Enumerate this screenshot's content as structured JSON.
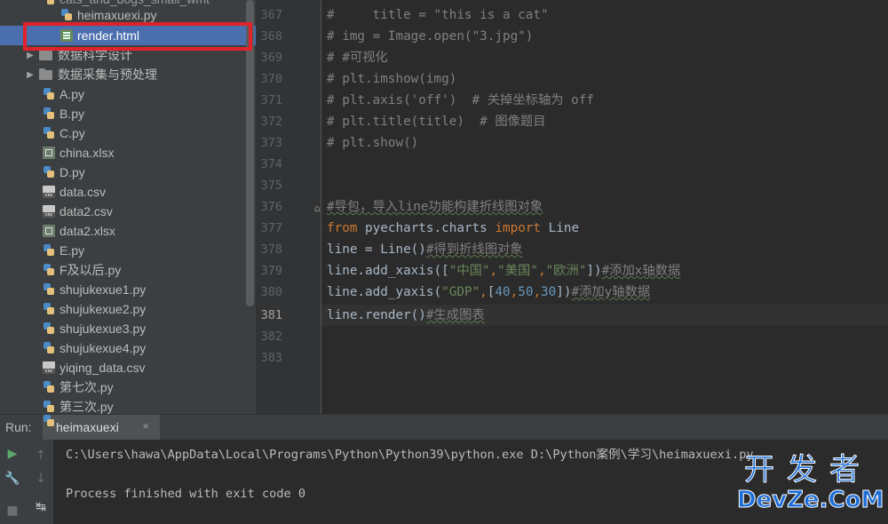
{
  "project_tree": {
    "items": [
      {
        "label": "cats_and_dogs_small_wmt",
        "type": "py",
        "indent": 2
      },
      {
        "label": "heimaxuexi.py",
        "type": "py",
        "indent": 2
      },
      {
        "label": "render.html",
        "type": "html",
        "indent": 2,
        "selected": true
      },
      {
        "label": "数据科学设计",
        "type": "folder",
        "indent": 1
      },
      {
        "label": "数据采集与预处理",
        "type": "folder",
        "indent": 1
      },
      {
        "label": "A.py",
        "type": "py",
        "indent": 1
      },
      {
        "label": "B.py",
        "type": "py",
        "indent": 1
      },
      {
        "label": "C.py",
        "type": "py",
        "indent": 1
      },
      {
        "label": "china.xlsx",
        "type": "xlsx",
        "indent": 1
      },
      {
        "label": "D.py",
        "type": "py",
        "indent": 1
      },
      {
        "label": "data.csv",
        "type": "csv",
        "indent": 1
      },
      {
        "label": "data2.csv",
        "type": "csv",
        "indent": 1
      },
      {
        "label": "data2.xlsx",
        "type": "xlsx",
        "indent": 1
      },
      {
        "label": "E.py",
        "type": "py",
        "indent": 1
      },
      {
        "label": "F及以后.py",
        "type": "py",
        "indent": 1
      },
      {
        "label": "shujukexue1.py",
        "type": "py",
        "indent": 1
      },
      {
        "label": "shujukexue2.py",
        "type": "py",
        "indent": 1
      },
      {
        "label": "shujukexue3.py",
        "type": "py",
        "indent": 1
      },
      {
        "label": "shujukexue4.py",
        "type": "py",
        "indent": 1
      },
      {
        "label": "yiqing_data.csv",
        "type": "csv",
        "indent": 1
      },
      {
        "label": "第七次.py",
        "type": "py",
        "indent": 1
      },
      {
        "label": "第三次.py",
        "type": "py",
        "indent": 1
      }
    ]
  },
  "editor": {
    "line_numbers": [
      "367",
      "368",
      "369",
      "370",
      "371",
      "372",
      "373",
      "374",
      "375",
      "376",
      "377",
      "378",
      "379",
      "380",
      "381",
      "382",
      "383"
    ],
    "current_line": "381",
    "lines": {
      "l367": "#     title = \"this is a cat\"",
      "l368": "# img = Image.open(\"3.jpg\")",
      "l369": "# #可视化",
      "l370": "# plt.imshow(img)",
      "l371": "# plt.axis('off')  # 关掉坐标轴为 off",
      "l372": "# plt.title(title)  # 图像题目",
      "l373": "# plt.show()",
      "l376": "#导包，导入line功能构建折线图对象",
      "l377_from": "from",
      "l377_mod": " pyecharts.charts ",
      "l377_import": "import",
      "l377_name": " Line",
      "l378_code": "line = Line()",
      "l378_cm": "#得到折线图对象",
      "l379_a": "line.add_xaxis([",
      "l379_s1": "\"中国\"",
      "l379_c1": ",",
      "l379_s2": "\"美国\"",
      "l379_c2": ",",
      "l379_s3": "\"欧洲\"",
      "l379_b": "])",
      "l379_cm": "#添加x轴数据",
      "l380_a": "line.add_yaxis(",
      "l380_s1": "\"GDP\"",
      "l380_c1": ",",
      "l380_br": "[",
      "l380_n1": "40",
      "l380_c2": ",",
      "l380_n2": "50",
      "l380_c3": ",",
      "l380_n3": "30",
      "l380_br2": "]",
      "l380_b": ")",
      "l380_cm": "#添加y轴数据",
      "l381_code": "line.render()",
      "l381_cm": "#生成图表"
    }
  },
  "run_panel": {
    "label": "Run:",
    "tab_label": "heimaxuexi",
    "tab_close": "×",
    "console_command": "C:\\Users\\hawa\\AppData\\Local\\Programs\\Python\\Python39\\python.exe D:\\Python案例\\学习\\heimaxuexi.py",
    "console_result": "Process finished with exit code 0"
  },
  "watermark": {
    "cn": "开发者",
    "en": "DevZe.CoM"
  },
  "colors": {
    "selection": "#4b6eaf",
    "highlight_box": "#e0232a",
    "keyword": "#cc7832",
    "string": "#6a8759",
    "number": "#6897bb",
    "comment": "#808080"
  }
}
